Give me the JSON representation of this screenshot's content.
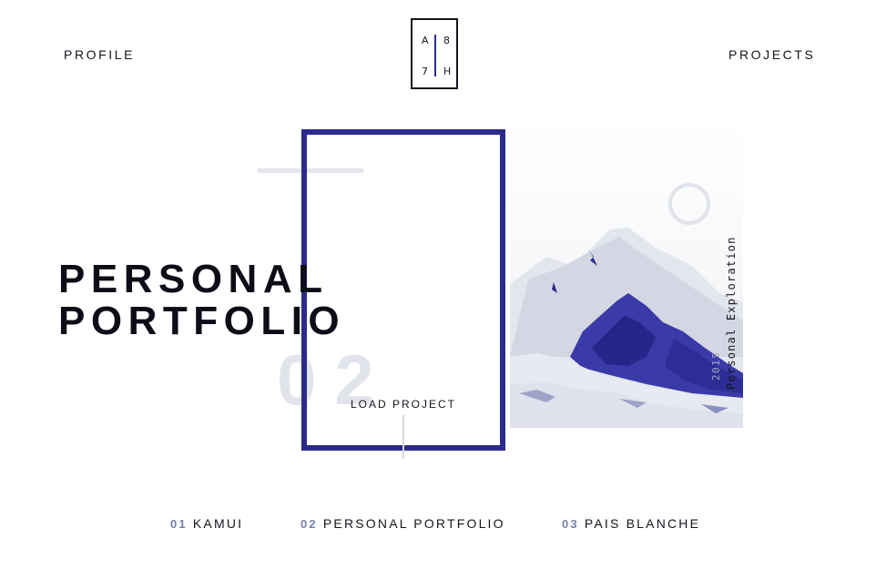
{
  "nav": {
    "profile_label": "PROFILE",
    "projects_label": "PROJECTS"
  },
  "logo": {
    "top_left": "A",
    "top_right": "8",
    "bottom_left": "7",
    "bottom_right": "H"
  },
  "hero": {
    "title_line1": "PERSONAL",
    "title_line2": "PORTFOLIO",
    "index_number": "02",
    "load_label": "LOAD PROJECT",
    "side_title": "Personal Exploration",
    "side_year": "2015"
  },
  "project_list": [
    {
      "num": "01",
      "label": "KAMUI"
    },
    {
      "num": "02",
      "label": "PERSONAL PORTFOLIO"
    },
    {
      "num": "03",
      "label": "PAIS BLANCHE"
    }
  ],
  "colors": {
    "accent": "#2b2b8c",
    "text": "#15151f",
    "muted": "#e2e4eb",
    "number": "#7a7fa8"
  }
}
